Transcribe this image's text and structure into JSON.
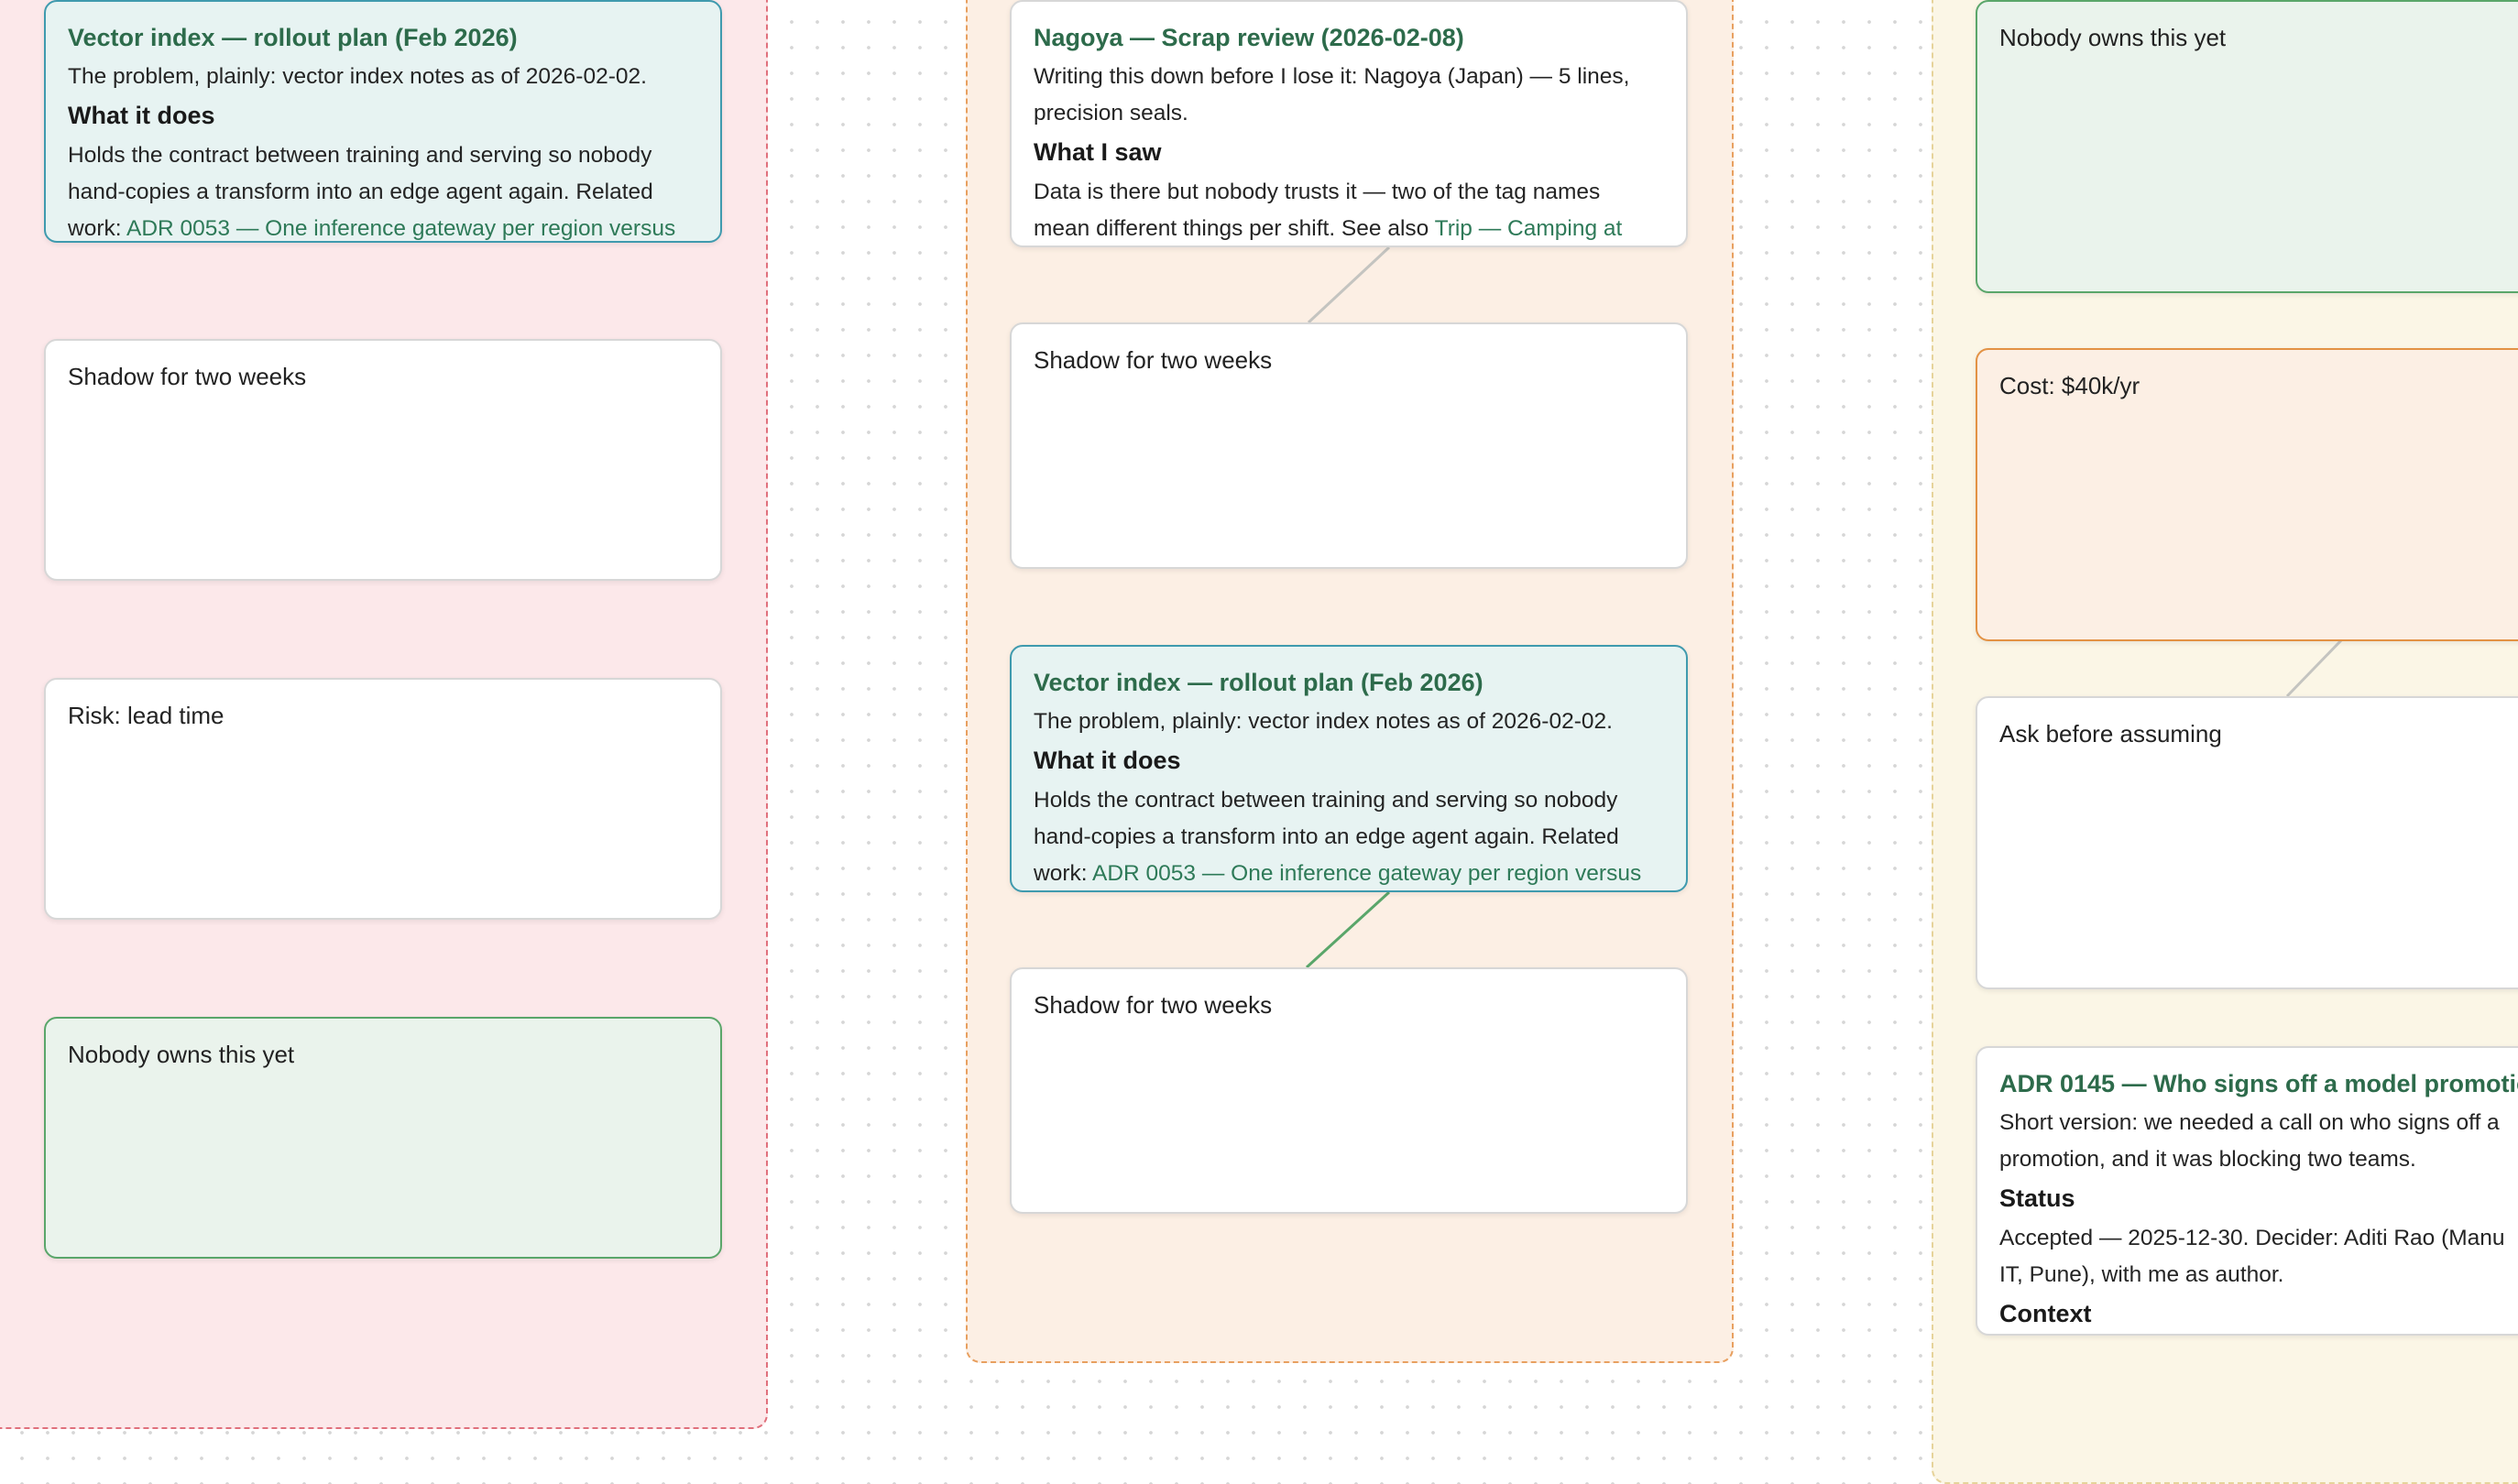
{
  "board": {
    "groups": [
      {
        "id": "group-left",
        "color": "#fce8ea"
      },
      {
        "id": "group-middle",
        "color": "#fcefe4"
      },
      {
        "id": "group-right",
        "color": "#fbf6e6"
      }
    ],
    "left_column": {
      "card1": {
        "title": "Vector index — rollout plan (Feb 2026)",
        "intro": "The problem, plainly: vector index notes as of 2026-02-02.",
        "heading": "What it does",
        "body_line1": "Holds the contract between training and serving so nobody",
        "body_line2": "hand-copies a transform into an edge agent again. Related",
        "body_line3_prefix": "work: ",
        "body_line3_link": "ADR 0053 — One inference gateway per region versus"
      },
      "card2": {
        "text": "Shadow for two weeks"
      },
      "card3": {
        "text": "Risk: lead time"
      },
      "card4": {
        "text": "Nobody owns this yet"
      }
    },
    "middle_column": {
      "card1": {
        "title": "Nagoya — Scrap review (2026-02-08)",
        "intro_line1": "Writing this down before I lose it: Nagoya (Japan) — 5 lines,",
        "intro_line2": "precision seals.",
        "heading": "What I saw",
        "body_line1": "Data is there but nobody trusts it — two of the tag names",
        "body_line2_prefix": "mean different things per shift. See also ",
        "body_line2_link": "Trip — Camping at"
      },
      "card2": {
        "text": "Shadow for two weeks"
      },
      "card3": {
        "title": "Vector index — rollout plan (Feb 2026)",
        "intro": "The problem, plainly: vector index notes as of 2026-02-02.",
        "heading": "What it does",
        "body_line1": "Holds the contract between training and serving so nobody",
        "body_line2": "hand-copies a transform into an edge agent again. Related",
        "body_line3_prefix": "work: ",
        "body_line3_link": "ADR 0053 — One inference gateway per region versus"
      },
      "card4": {
        "text": "Shadow for two weeks"
      }
    },
    "right_column": {
      "card1": {
        "text": "Nobody owns this yet"
      },
      "card2": {
        "text": "Cost: $40k/yr"
      },
      "card3": {
        "text": "Ask before assuming"
      },
      "card4": {
        "title": "ADR 0145 — Who signs off a model promotio",
        "intro_line1": "Short version: we needed a call on who signs off a",
        "intro_line2": "promotion, and it was blocking two teams.",
        "heading1": "Status",
        "status_line1": "Accepted — 2025-12-30. Decider: Aditi Rao (Manu",
        "status_line2": "IT, Pune), with me as author.",
        "heading2": "Context"
      }
    }
  }
}
